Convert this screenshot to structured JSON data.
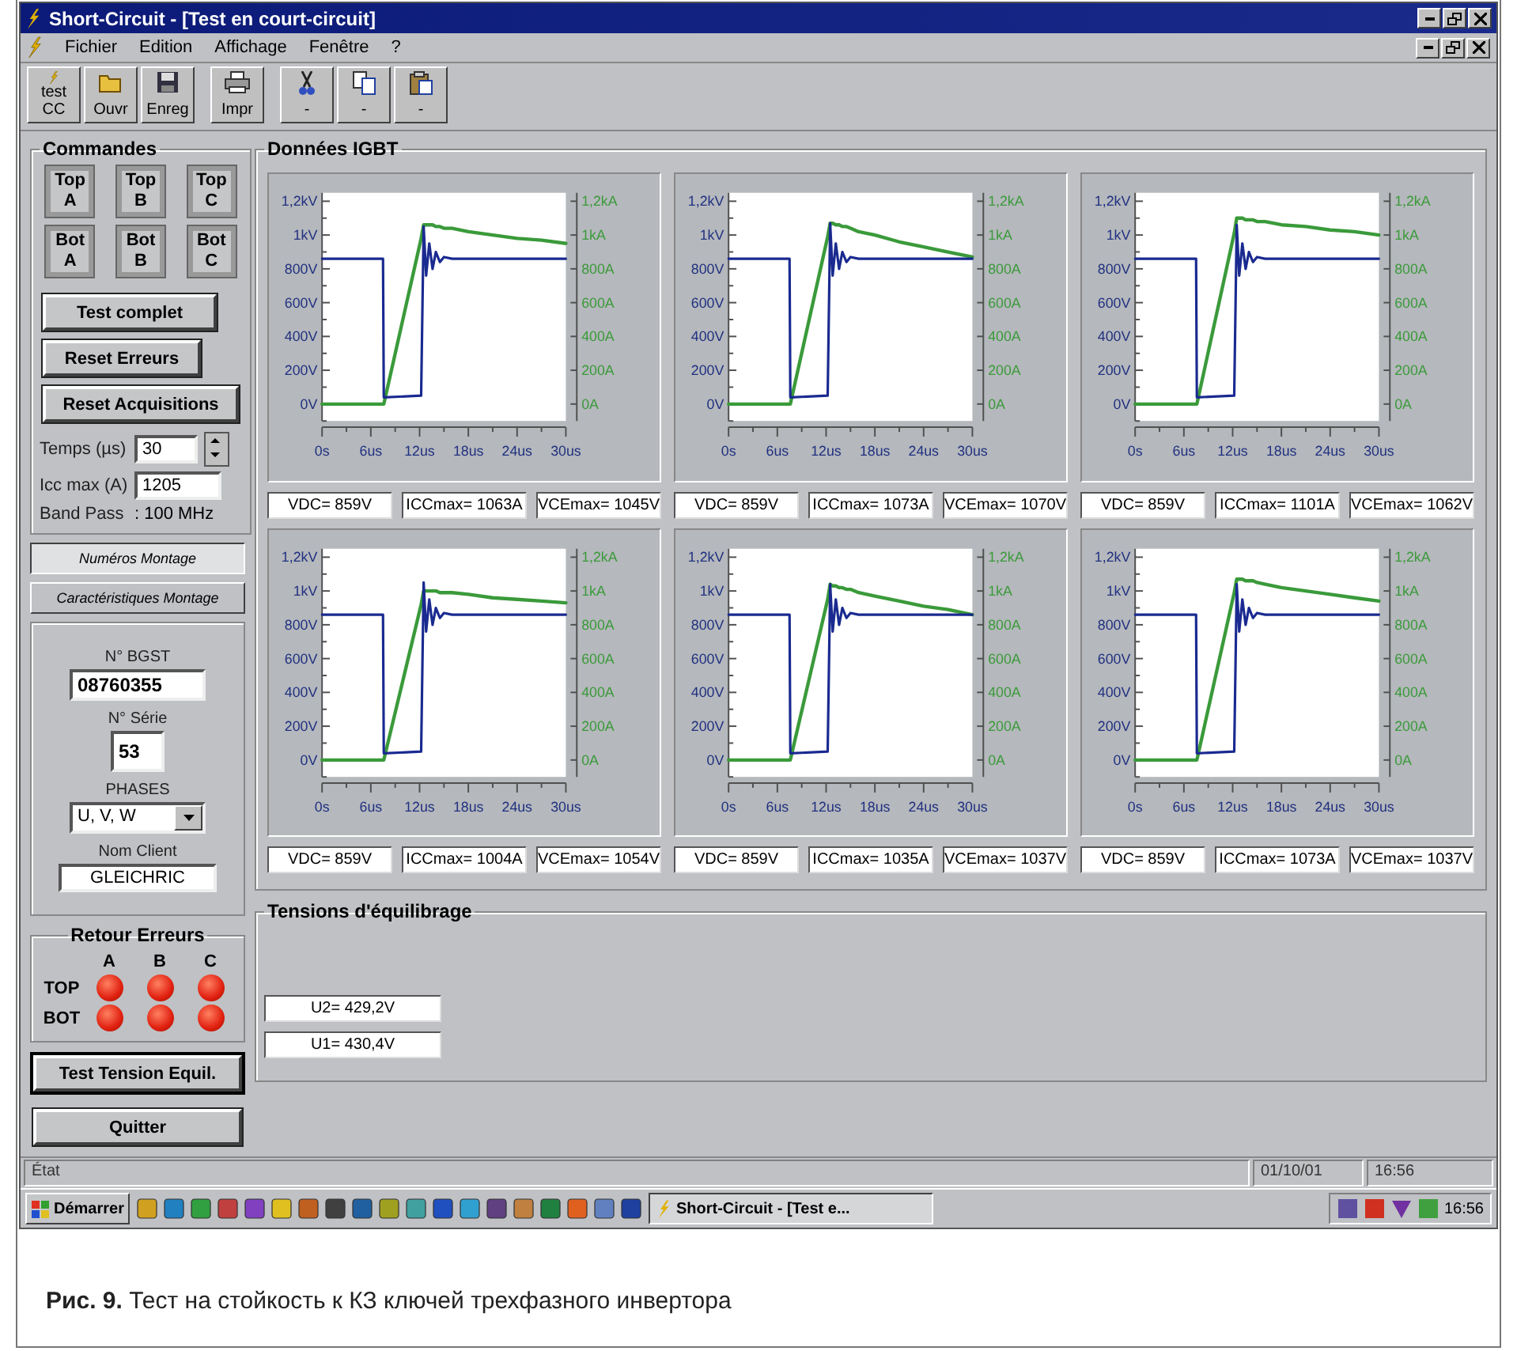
{
  "window": {
    "title": "Short-Circuit - [Test en court-circuit]"
  },
  "menu": [
    "Fichier",
    "Edition",
    "Affichage",
    "Fenêtre",
    "?"
  ],
  "toolbar": [
    {
      "kind": "bolt",
      "label": "test CC"
    },
    {
      "kind": "open",
      "label": "Ouvr"
    },
    {
      "kind": "save",
      "label": "Enreg"
    },
    {
      "kind": "print",
      "label": "Impr"
    },
    {
      "kind": "cut",
      "label": "-"
    },
    {
      "kind": "copy",
      "label": "-"
    },
    {
      "kind": "paste",
      "label": "-"
    }
  ],
  "commandes": {
    "title": "Commandes",
    "switches": [
      {
        "line1": "Top",
        "line2": "A"
      },
      {
        "line1": "Top",
        "line2": "B"
      },
      {
        "line1": "Top",
        "line2": "C"
      },
      {
        "line1": "Bot",
        "line2": "A"
      },
      {
        "line1": "Bot",
        "line2": "B"
      },
      {
        "line1": "Bot",
        "line2": "C"
      }
    ],
    "buttons": [
      "Test complet",
      "Reset Erreurs",
      "Reset Acquisitions"
    ],
    "temps": {
      "label": "Temps (µs)",
      "value": "30"
    },
    "icc": {
      "label": "Icc max (A)",
      "value": "1205"
    },
    "band": {
      "label": "Band Pass",
      "value": ": 100 MHz"
    }
  },
  "tabs": [
    {
      "label": "Numéros Montage",
      "selected": true
    },
    {
      "label": "Caractéristiques Montage",
      "selected": false
    }
  ],
  "montage": {
    "bgst": {
      "label": "N° BGST",
      "value": "08760355"
    },
    "serie": {
      "label": "N° Série",
      "value": "53"
    },
    "phases": {
      "label": "PHASES",
      "value": "U, V, W"
    },
    "client": {
      "label": "Nom Client",
      "value": "GLEICHRIC"
    }
  },
  "errors": {
    "title": "Retour Erreurs",
    "columns": [
      "A",
      "B",
      "C"
    ],
    "rows": [
      {
        "label": "TOP",
        "leds": [
          {
            "on": true
          },
          {
            "on": true
          },
          {
            "on": true
          }
        ]
      },
      {
        "label": "BOT",
        "leds": [
          {
            "on": true
          },
          {
            "on": true
          },
          {
            "on": true
          }
        ]
      }
    ]
  },
  "bottom_buttons": [
    {
      "label": "Test Tension Equil.",
      "focused": true
    },
    {
      "label": "Quitter",
      "focused": false
    }
  ],
  "igbt": {
    "title": "Données IGBT",
    "charts": [
      {
        "chart_data": {
          "type": "line",
          "x": [
            0,
            7.5,
            7.6,
            12.2,
            12.5,
            12.8,
            13.2,
            13.6,
            14,
            14.5,
            15,
            16,
            18,
            21,
            24,
            27,
            30
          ],
          "xlim": [
            0,
            30
          ],
          "ylim": [
            -100,
            1250
          ],
          "xticks": [
            {
              "value": 0,
              "label": "0s"
            },
            {
              "value": 6,
              "label": "6us"
            },
            {
              "value": 12,
              "label": "12us"
            },
            {
              "value": 18,
              "label": "18us"
            },
            {
              "value": 24,
              "label": "24us"
            },
            {
              "value": 30,
              "label": "30us"
            }
          ],
          "yticks": [
            {
              "value": 800,
              "label": "800V"
            },
            {
              "value": 600,
              "label": "600V"
            },
            {
              "value": 400,
              "label": "400V"
            },
            {
              "value": 200,
              "label": "200V"
            },
            {
              "value": 0,
              "label": "0V"
            }
          ],
          "series": [
            {
              "color": "#1a2a90",
              "values": [
                860,
                860,
                40,
                50,
                1050,
                760,
                950,
                800,
                900,
                840,
                870,
                860,
                860,
                860,
                860,
                860,
                860
              ]
            },
            {
              "color": "#3a9a3a",
              "values": [
                0,
                0,
                0,
                980,
                1060,
                1060,
                1060,
                1060,
                1050,
                1050,
                1040,
                1040,
                1020,
                1000,
                980,
                970,
                950
              ]
            }
          ]
        },
        "y_left_top": [
          "1,2kV",
          "1kV"
        ],
        "y_right": [
          "1,2kA",
          "1kA",
          "800A",
          "600A",
          "400A",
          "200A",
          "0A"
        ],
        "readings": [
          "VDC= 859V",
          "ICCmax= 1063A",
          "VCEmax= 1045V"
        ]
      },
      {
        "chart_data": {
          "type": "line",
          "x": [
            0,
            7.5,
            7.6,
            12.2,
            12.5,
            12.8,
            13.2,
            13.6,
            14,
            14.5,
            15,
            16,
            18,
            21,
            24,
            27,
            30
          ],
          "xlim": [
            0,
            30
          ],
          "ylim": [
            -100,
            1250
          ],
          "xticks": [
            {
              "value": 0,
              "label": "0s"
            },
            {
              "value": 6,
              "label": "6us"
            },
            {
              "value": 12,
              "label": "12us"
            },
            {
              "value": 18,
              "label": "18us"
            },
            {
              "value": 24,
              "label": "24us"
            },
            {
              "value": 30,
              "label": "30us"
            }
          ],
          "yticks": [
            {
              "value": 800,
              "label": "800V"
            },
            {
              "value": 600,
              "label": "600V"
            },
            {
              "value": 400,
              "label": "400V"
            },
            {
              "value": 200,
              "label": "200V"
            },
            {
              "value": 0,
              "label": "0V"
            }
          ],
          "series": [
            {
              "color": "#1a2a90",
              "values": [
                860,
                860,
                40,
                50,
                1070,
                760,
                950,
                800,
                900,
                840,
                870,
                860,
                860,
                860,
                860,
                860,
                860
              ]
            },
            {
              "color": "#3a9a3a",
              "values": [
                0,
                0,
                0,
                990,
                1070,
                1070,
                1060,
                1060,
                1050,
                1050,
                1040,
                1020,
                1000,
                960,
                930,
                900,
                870
              ]
            }
          ]
        },
        "y_left_top": [
          "1,2kV",
          "1kV"
        ],
        "y_right": [
          "1,2kA",
          "1kA",
          "800A",
          "600A",
          "400A",
          "200A",
          "0A"
        ],
        "readings": [
          "VDC= 859V",
          "ICCmax= 1073A",
          "VCEmax= 1070V"
        ]
      },
      {
        "chart_data": {
          "type": "line",
          "x": [
            0,
            7.5,
            7.6,
            12.2,
            12.5,
            12.8,
            13.2,
            13.6,
            14,
            14.5,
            15,
            16,
            18,
            21,
            24,
            27,
            30
          ],
          "xlim": [
            0,
            30
          ],
          "ylim": [
            -100,
            1250
          ],
          "xticks": [
            {
              "value": 0,
              "label": "0s"
            },
            {
              "value": 6,
              "label": "6us"
            },
            {
              "value": 12,
              "label": "12us"
            },
            {
              "value": 18,
              "label": "18us"
            },
            {
              "value": 24,
              "label": "24us"
            },
            {
              "value": 30,
              "label": "30us"
            }
          ],
          "yticks": [
            {
              "value": 800,
              "label": "800V"
            },
            {
              "value": 600,
              "label": "600V"
            },
            {
              "value": 400,
              "label": "400V"
            },
            {
              "value": 200,
              "label": "200V"
            },
            {
              "value": 0,
              "label": "0V"
            }
          ],
          "series": [
            {
              "color": "#1a2a90",
              "values": [
                860,
                860,
                40,
                50,
                1060,
                760,
                950,
                800,
                900,
                840,
                870,
                860,
                860,
                860,
                860,
                860,
                860
              ]
            },
            {
              "color": "#3a9a3a",
              "values": [
                0,
                0,
                0,
                1010,
                1100,
                1100,
                1100,
                1090,
                1090,
                1090,
                1080,
                1080,
                1060,
                1050,
                1030,
                1020,
                1000
              ]
            }
          ]
        },
        "y_left_top": [
          "1,2kV",
          "1kV"
        ],
        "y_right": [
          "1,2kA",
          "1kA",
          "800A",
          "600A",
          "400A",
          "200A",
          "0A"
        ],
        "readings": [
          "VDC= 859V",
          "ICCmax= 1101A",
          "VCEmax= 1062V"
        ]
      },
      {
        "chart_data": {
          "type": "line",
          "x": [
            0,
            7.5,
            7.6,
            12.2,
            12.5,
            12.8,
            13.2,
            13.6,
            14,
            14.5,
            15,
            16,
            18,
            21,
            24,
            27,
            30
          ],
          "xlim": [
            0,
            30
          ],
          "ylim": [
            -100,
            1250
          ],
          "xticks": [
            {
              "value": 0,
              "label": "0s"
            },
            {
              "value": 6,
              "label": "6us"
            },
            {
              "value": 12,
              "label": "12us"
            },
            {
              "value": 18,
              "label": "18us"
            },
            {
              "value": 24,
              "label": "24us"
            },
            {
              "value": 30,
              "label": "30us"
            }
          ],
          "yticks": [
            {
              "value": 800,
              "label": "800V"
            },
            {
              "value": 600,
              "label": "600V"
            },
            {
              "value": 400,
              "label": "400V"
            },
            {
              "value": 200,
              "label": "200V"
            },
            {
              "value": 0,
              "label": "0V"
            }
          ],
          "series": [
            {
              "color": "#1a2a90",
              "values": [
                860,
                860,
                40,
                50,
                1050,
                760,
                950,
                800,
                900,
                840,
                870,
                860,
                860,
                860,
                860,
                860,
                860
              ]
            },
            {
              "color": "#3a9a3a",
              "values": [
                0,
                0,
                0,
                920,
                1000,
                1000,
                1000,
                1000,
                1000,
                990,
                990,
                990,
                980,
                960,
                950,
                940,
                930
              ]
            }
          ]
        },
        "y_left_top": [
          "1,2kV",
          "1kV"
        ],
        "y_right": [
          "1,2kA",
          "1kA",
          "800A",
          "600A",
          "400A",
          "200A",
          "0A"
        ],
        "readings": [
          "VDC= 859V",
          "ICCmax= 1004A",
          "VCEmax= 1054V"
        ]
      },
      {
        "chart_data": {
          "type": "line",
          "x": [
            0,
            7.5,
            7.6,
            12.2,
            12.5,
            12.8,
            13.2,
            13.6,
            14,
            14.5,
            15,
            16,
            18,
            21,
            24,
            27,
            30
          ],
          "xlim": [
            0,
            30
          ],
          "ylim": [
            -100,
            1250
          ],
          "xticks": [
            {
              "value": 0,
              "label": "0s"
            },
            {
              "value": 6,
              "label": "6us"
            },
            {
              "value": 12,
              "label": "12us"
            },
            {
              "value": 18,
              "label": "18us"
            },
            {
              "value": 24,
              "label": "24us"
            },
            {
              "value": 30,
              "label": "30us"
            }
          ],
          "yticks": [
            {
              "value": 800,
              "label": "800V"
            },
            {
              "value": 600,
              "label": "600V"
            },
            {
              "value": 400,
              "label": "400V"
            },
            {
              "value": 200,
              "label": "200V"
            },
            {
              "value": 0,
              "label": "0V"
            }
          ],
          "series": [
            {
              "color": "#1a2a90",
              "values": [
                860,
                860,
                40,
                50,
                1040,
                760,
                950,
                800,
                900,
                840,
                870,
                860,
                860,
                860,
                860,
                860,
                860
              ]
            },
            {
              "color": "#3a9a3a",
              "values": [
                0,
                0,
                0,
                950,
                1040,
                1030,
                1030,
                1020,
                1020,
                1010,
                1010,
                990,
                970,
                940,
                910,
                890,
                860
              ]
            }
          ]
        },
        "y_left_top": [
          "1,2kV",
          "1kV"
        ],
        "y_right": [
          "1,2kA",
          "1kA",
          "800A",
          "600A",
          "400A",
          "200A",
          "0A"
        ],
        "readings": [
          "VDC= 859V",
          "ICCmax= 1035A",
          "VCEmax= 1037V"
        ]
      },
      {
        "chart_data": {
          "type": "line",
          "x": [
            0,
            7.5,
            7.6,
            12.2,
            12.5,
            12.8,
            13.2,
            13.6,
            14,
            14.5,
            15,
            16,
            18,
            21,
            24,
            27,
            30
          ],
          "xlim": [
            0,
            30
          ],
          "ylim": [
            -100,
            1250
          ],
          "xticks": [
            {
              "value": 0,
              "label": "0s"
            },
            {
              "value": 6,
              "label": "6us"
            },
            {
              "value": 12,
              "label": "12us"
            },
            {
              "value": 18,
              "label": "18us"
            },
            {
              "value": 24,
              "label": "24us"
            },
            {
              "value": 30,
              "label": "30us"
            }
          ],
          "yticks": [
            {
              "value": 800,
              "label": "800V"
            },
            {
              "value": 600,
              "label": "600V"
            },
            {
              "value": 400,
              "label": "400V"
            },
            {
              "value": 200,
              "label": "200V"
            },
            {
              "value": 0,
              "label": "0V"
            }
          ],
          "series": [
            {
              "color": "#1a2a90",
              "values": [
                860,
                860,
                40,
                50,
                1040,
                760,
                950,
                800,
                900,
                840,
                870,
                860,
                860,
                860,
                860,
                860,
                860
              ]
            },
            {
              "color": "#3a9a3a",
              "values": [
                0,
                0,
                0,
                990,
                1070,
                1070,
                1070,
                1060,
                1060,
                1060,
                1050,
                1040,
                1020,
                1000,
                980,
                960,
                940
              ]
            }
          ]
        },
        "y_left_top": [
          "1,2kV",
          "1kV"
        ],
        "y_right": [
          "1,2kA",
          "1kA",
          "800A",
          "600A",
          "400A",
          "200A",
          "0A"
        ],
        "readings": [
          "VDC= 859V",
          "ICCmax= 1073A",
          "VCEmax= 1037V"
        ]
      }
    ]
  },
  "tensions": {
    "title": "Tensions d'équilibrage",
    "values": [
      "U2= 429,2V",
      "U1= 430,4V"
    ]
  },
  "status_bar": [
    "État",
    "01/10/01",
    "16:56"
  ],
  "taskbar": {
    "start": "Démarrer",
    "task": "Short-Circuit - [Test e...",
    "clock": "16:56"
  },
  "caption": "**Рис. 9.** Тест на стойкость к КЗ ключей трехфазного инвертора"
}
